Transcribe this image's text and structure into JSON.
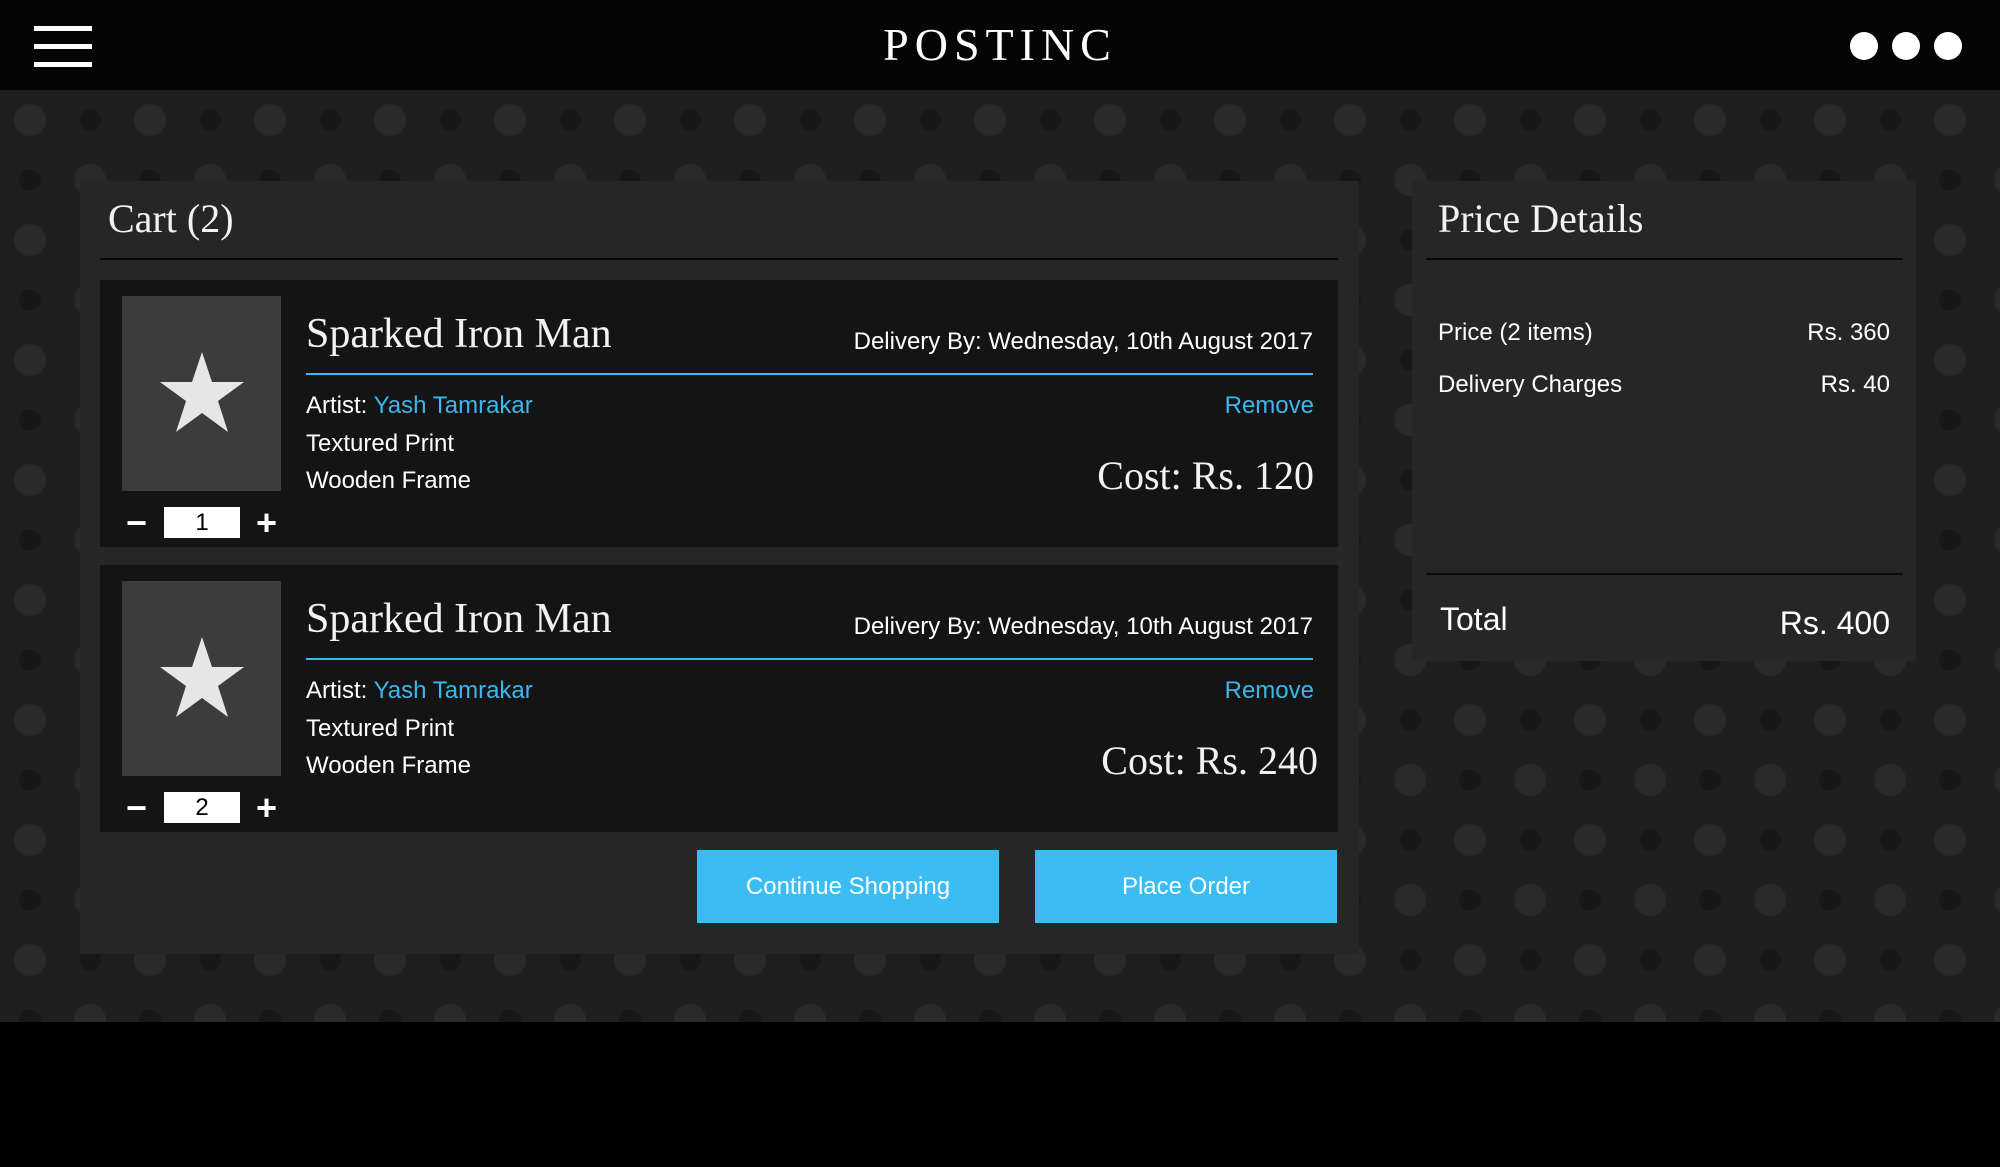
{
  "header": {
    "logo": "POSTINC"
  },
  "cart": {
    "title": "Cart (2)",
    "items": [
      {
        "name": "Sparked Iron Man",
        "delivery": "Delivery By: Wednesday, 10th August 2017",
        "artist_label": "Artist:",
        "artist_name": "Yash Tamrakar",
        "remove_label": "Remove",
        "print_type": "Textured Print",
        "frame": "Wooden Frame",
        "cost": "Cost: Rs. 120",
        "quantity": "1",
        "minus": "−",
        "plus": "+"
      },
      {
        "name": "Sparked Iron Man",
        "delivery": "Delivery By: Wednesday, 10th August 2017",
        "artist_label": "Artist:",
        "artist_name": "Yash Tamrakar",
        "remove_label": "Remove",
        "print_type": "Textured Print",
        "frame": "Wooden Frame",
        "cost": "Cost: Rs. 240",
        "quantity": "2",
        "minus": "−",
        "plus": "+"
      }
    ],
    "continue_label": "Continue Shopping",
    "order_label": "Place Order"
  },
  "price": {
    "title": "Price Details",
    "rows": [
      {
        "label": "Price (2 items)",
        "value": "Rs. 360"
      },
      {
        "label": "Delivery Charges",
        "value": "Rs. 40"
      }
    ],
    "total_label": "Total",
    "total_value": "Rs. 400"
  },
  "icons": {
    "menu": "hamburger-menu-icon",
    "more": "more-dots-icon",
    "thumbnail": "star-icon"
  },
  "colors": {
    "accent": "#3bb7ee",
    "button": "#3bbcf2",
    "panel": "#262626",
    "item_bg": "#141414"
  }
}
